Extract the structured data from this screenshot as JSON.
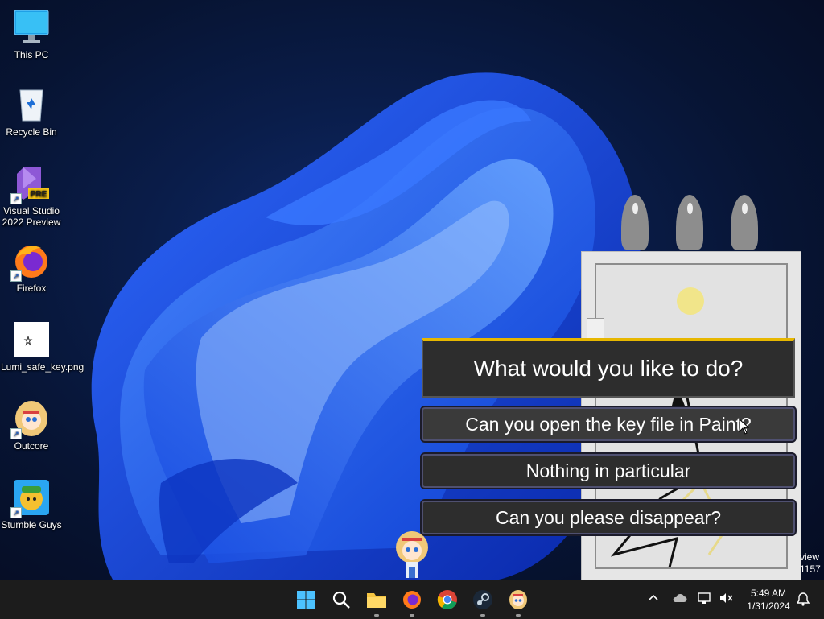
{
  "desktop": {
    "icons": [
      {
        "label": "This PC",
        "icon": "monitor-icon"
      },
      {
        "label": "Recycle Bin",
        "icon": "recycle-bin-icon"
      },
      {
        "label": "Visual Studio 2022 Preview",
        "icon": "visual-studio-icon",
        "badge": "PRE"
      },
      {
        "label": "Firefox",
        "icon": "firefox-icon"
      },
      {
        "label": "Lumi_safe_key.png",
        "icon": "image-file-icon"
      },
      {
        "label": "Outcore",
        "icon": "outcore-icon"
      },
      {
        "label": "Stumble Guys",
        "icon": "stumble-guys-icon"
      }
    ]
  },
  "dialog": {
    "question": "What would you like to do?",
    "options": [
      "Can you open the key file in Paint?",
      "Nothing in particular",
      "Can you please disappear?"
    ]
  },
  "watermark": {
    "line1": "view",
    "line2": "1157"
  },
  "taskbar": {
    "apps": [
      "start-icon",
      "search-icon",
      "file-explorer-icon",
      "firefox-icon",
      "chrome-icon",
      "steam-icon",
      "outcore-icon"
    ],
    "time": "5:49 AM",
    "date": "1/31/2024"
  },
  "colors": {
    "accent_bar": "#e7b700",
    "taskbar": "#1c1c1c"
  }
}
